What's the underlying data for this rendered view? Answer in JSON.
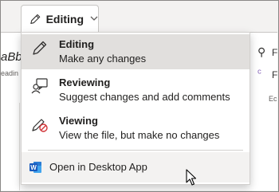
{
  "toolbar": {
    "editing_button_label": "Editing",
    "chevron": "⌄"
  },
  "ribbon": {
    "styles_sample": "aBb",
    "styles_caption": "eadin",
    "right_group_letter1": "F",
    "right_group_letter2": "F",
    "right_group_caption": "Ec"
  },
  "menu": {
    "items": [
      {
        "title": "Editing",
        "description": "Make any changes",
        "icon": "pencil-icon",
        "selected": true
      },
      {
        "title": "Reviewing",
        "description": "Suggest changes and add comments",
        "icon": "reviewer-icon",
        "selected": false
      },
      {
        "title": "Viewing",
        "description": "View the file, but make no changes",
        "icon": "pencil-blocked-icon",
        "selected": false
      }
    ],
    "open_desktop_label": "Open in Desktop App",
    "open_desktop_icon": "word-app-icon"
  },
  "colors": {
    "selected_bg": "#e1dfdd",
    "menu_bg": "#ffffff",
    "word_blue": "#185abd",
    "blocked_red": "#d13438"
  }
}
